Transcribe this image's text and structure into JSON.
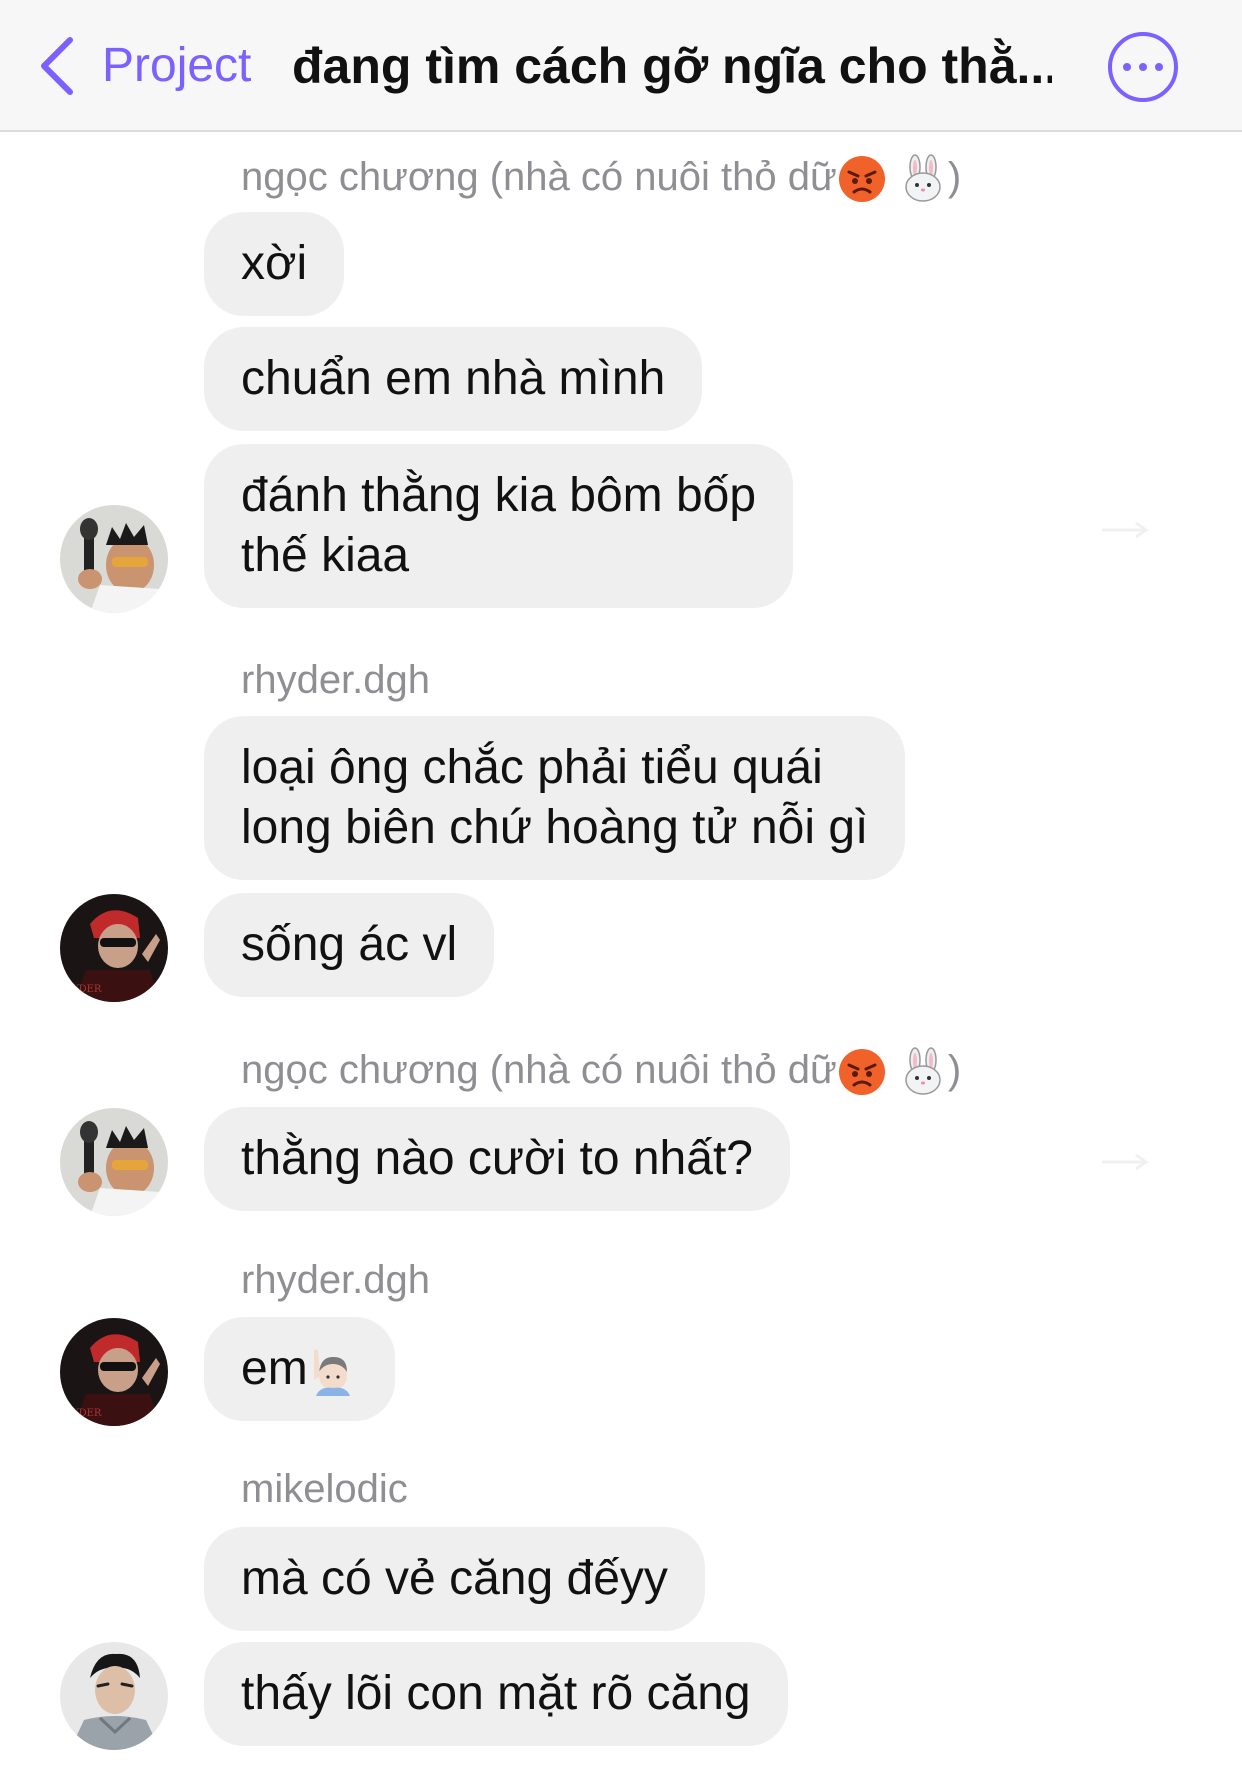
{
  "header": {
    "back_label": "Project",
    "title": "đang tìm cách gỡ ngĩa cho thằ..."
  },
  "messages": [
    {
      "sender": "ngọc chương (nhà có nuôi thỏ dữ",
      "sender_suffix": ")",
      "bubbles": [
        "xời",
        "chuẩn em nhà mình",
        "đánh thằng kia bôm bốp thế kiaa"
      ]
    },
    {
      "sender": "rhyder.dgh",
      "bubbles": [
        "loại ông chắc phải tiểu quái long biên chứ hoàng tử nỗi gì",
        "sống ác vl"
      ]
    },
    {
      "sender": "ngọc chương (nhà có nuôi thỏ dữ",
      "sender_suffix": ")",
      "bubbles": [
        "thằng nào cười to nhất?"
      ]
    },
    {
      "sender": "rhyder.dgh",
      "bubbles": [
        "em"
      ]
    },
    {
      "sender": "mikelodic",
      "bubbles": [
        "mà có vẻ căng đếyy",
        "thấy lõi con mặt rõ căng"
      ]
    }
  ],
  "lines": {
    "m1_b3_l1": "đánh thằng kia bôm bốp",
    "m1_b3_l2": "thế kiaa",
    "m2_b1_l1": "loại ông chắc phải tiểu quái",
    "m2_b1_l2": "long biên chứ hoàng tử nỗi gì"
  },
  "colors": {
    "accent": "#7b61ff",
    "bubble": "#efefef",
    "sender": "#8e8e93"
  },
  "icons": [
    "chevron-left-icon",
    "more-options-icon",
    "angry-face-emoji",
    "rabbit-emoji",
    "raising-hand-emoji"
  ]
}
